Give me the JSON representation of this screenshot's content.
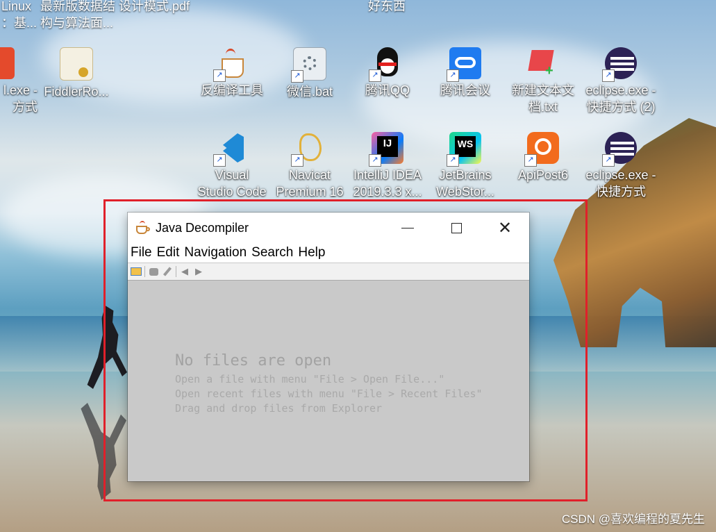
{
  "desktop": {
    "top_labels": [
      "Linux",
      "最新版数据结 设计模式.pdf",
      "好东西"
    ],
    "top_labels_row2": [
      "：基...",
      "构与算法面..."
    ],
    "row1": [
      {
        "label1": "l.exe -",
        "label2": "方式",
        "icon": "tool-icon"
      },
      {
        "label1": "FiddlerRo...",
        "label2": "",
        "icon": "certificate-icon"
      },
      {
        "label1": "反编译工具",
        "label2": "",
        "icon": "java-cup-icon"
      },
      {
        "label1": "微信.bat",
        "label2": "",
        "icon": "batch-gear-icon"
      },
      {
        "label1": "腾讯QQ",
        "label2": "",
        "icon": "qq-penguin-icon"
      },
      {
        "label1": "腾讯会议",
        "label2": "",
        "icon": "tencent-meeting-icon"
      },
      {
        "label1": "新建文本文",
        "label2": "档.txt",
        "icon": "text-file-icon"
      },
      {
        "label1": "eclipse.exe -",
        "label2": "快捷方式 (2)",
        "icon": "eclipse-icon"
      }
    ],
    "row2": [
      {
        "label1": "Visual",
        "label2": "Studio Code",
        "icon": "vscode-icon"
      },
      {
        "label1": "Navicat",
        "label2": "Premium 16",
        "icon": "navicat-icon"
      },
      {
        "label1": "IntelliJ IDEA",
        "label2": "2019.3.3 x...",
        "icon": "intellij-icon"
      },
      {
        "label1": "JetBrains",
        "label2": "WebStor...",
        "icon": "webstorm-icon"
      },
      {
        "label1": "ApiPost6",
        "label2": "",
        "icon": "apipost-icon"
      },
      {
        "label1": "eclipse.exe -",
        "label2": "快捷方式",
        "icon": "eclipse-icon"
      }
    ],
    "watermark": "CSDN @喜欢编程的夏先生"
  },
  "window": {
    "title": "Java Decompiler",
    "menu": [
      "File",
      "Edit",
      "Navigation",
      "Search",
      "Help"
    ],
    "toolbar": [
      "open-file-icon",
      "close-file-icon",
      "edit-icon",
      "back-icon",
      "forward-icon"
    ],
    "empty_heading": "No files are open",
    "empty_lines": [
      "Open a file with menu \"File > Open File...\"",
      "Open recent files with menu \"File > Recent Files\"",
      "Drag and drop files from Explorer"
    ]
  },
  "colors": {
    "highlight_frame": "#e0202a",
    "content_bg": "#c9c9c9",
    "empty_text": "#a9a9a9"
  }
}
